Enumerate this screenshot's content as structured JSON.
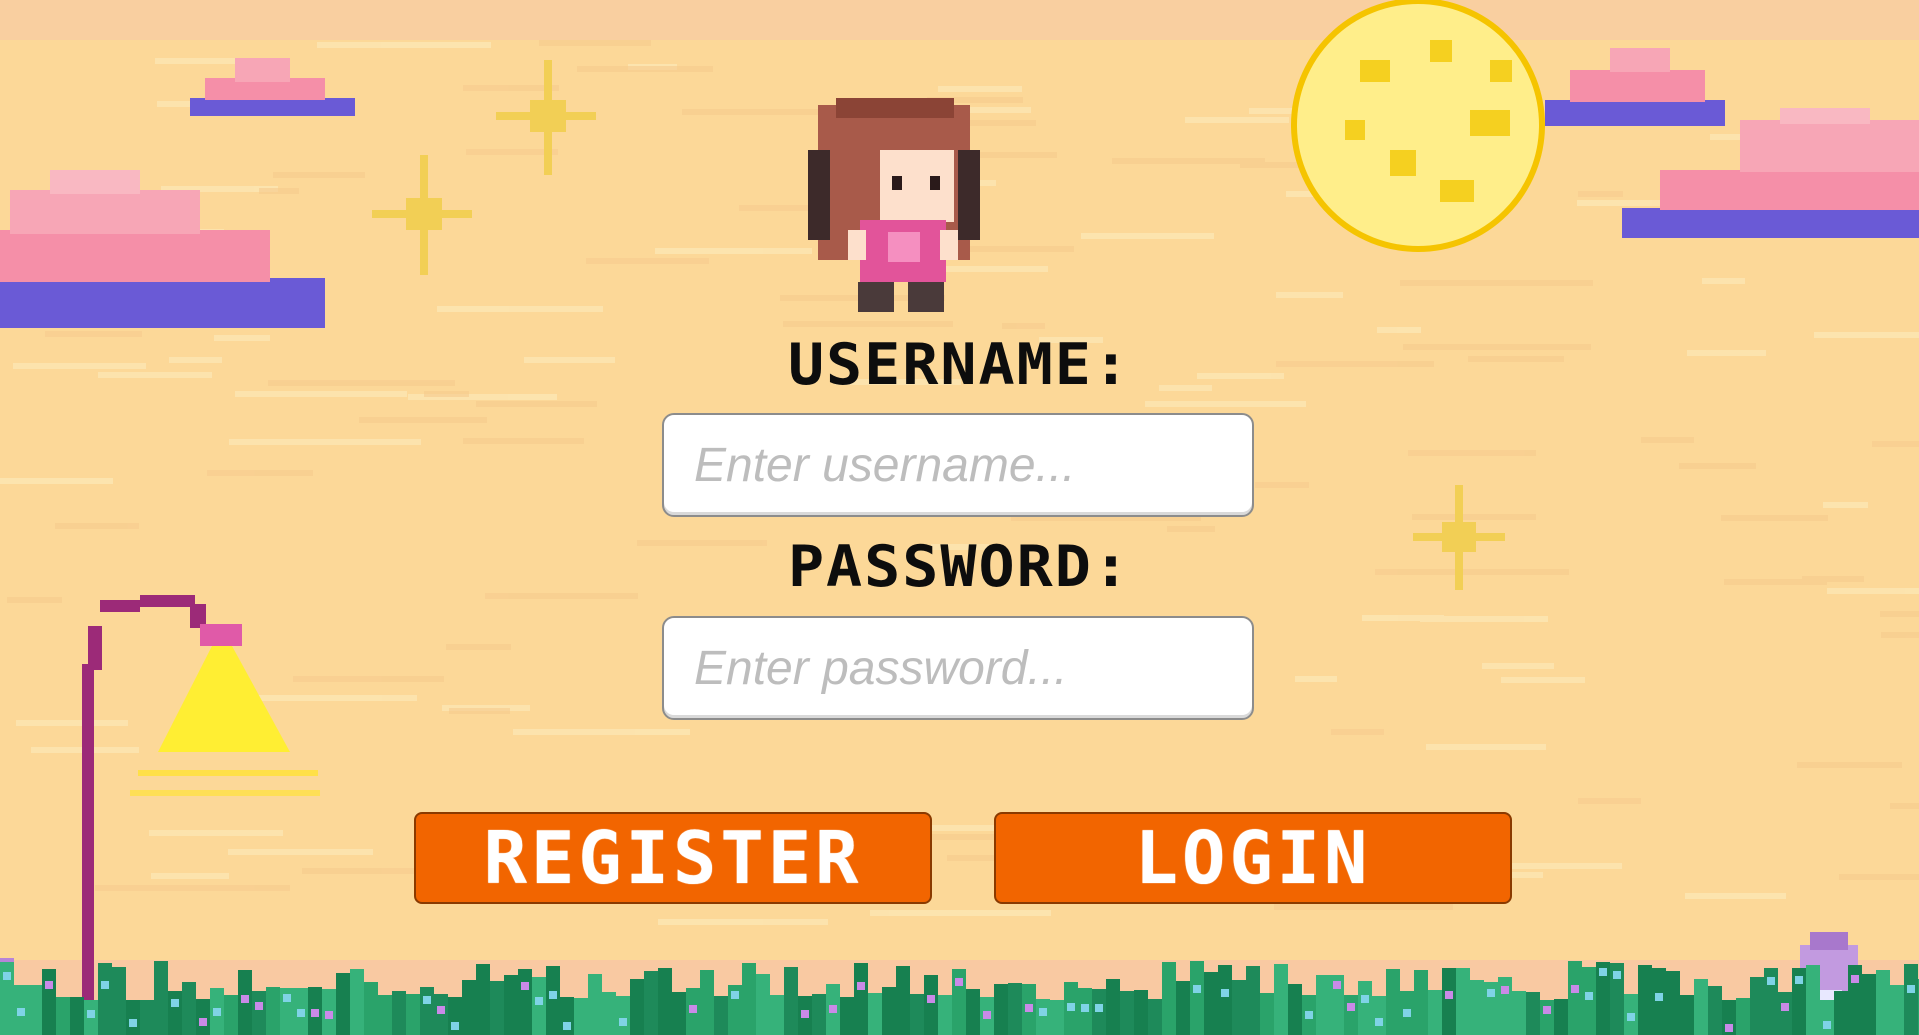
{
  "form": {
    "username_label": "USERNAME:",
    "username_placeholder": "Enter username...",
    "password_label": "PASSWORD:",
    "password_placeholder": "Enter password...",
    "register_label": "REGISTER",
    "login_label": "LOGIN"
  },
  "colors": {
    "sky": "#fcd898",
    "button": "#f26500",
    "cloud_top": "#f58fa8",
    "cloud_base": "#6a5ad6",
    "moon": "#fff07a",
    "grass": "#1e8a5a"
  }
}
